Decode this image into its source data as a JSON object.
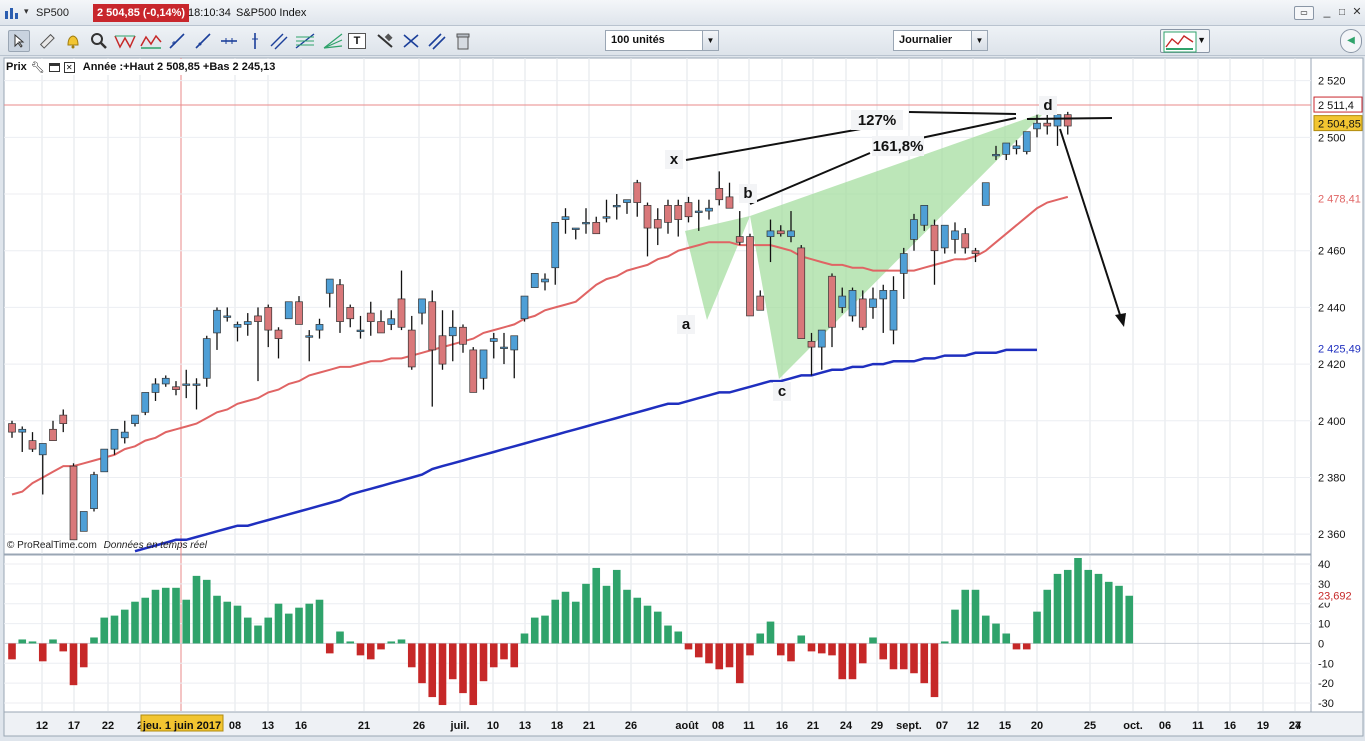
{
  "titlebar": {
    "symbol": "SP500",
    "price_badge": "2 504,85 (-0,14%)",
    "time": "18:10:34",
    "instrument": "S&P500 Index"
  },
  "toolbar": {
    "units_value": "100 unités",
    "period_value": "Journalier"
  },
  "chart_header": {
    "label": "Prix",
    "info": "Année :+Haut 2 508,85 +Bas 2 245,13"
  },
  "watermark": {
    "brand": "© ProRealTime.com",
    "realtime": "Données en temps réel"
  },
  "colors": {
    "up": "#4e9fd6",
    "down": "#d9787a",
    "ma_short": "#e06464",
    "ma_long": "#1f2fbf",
    "hist_up": "#2fa36b",
    "hist_down": "#c62828",
    "pattern_fill": "#9fdc9a"
  },
  "chart_data": [
    {
      "type": "candlestick",
      "title": "SP500",
      "ylim": [
        2353,
        2528
      ],
      "y_ticks": [
        2360,
        2380,
        2400,
        2420,
        2440,
        2460,
        2480,
        2500,
        2520
      ],
      "y_tick_labels": [
        "2 360",
        "2 380",
        "2 400",
        "2 420",
        "2 440",
        "2 460",
        "2 480",
        "2 500",
        "2 520"
      ],
      "x_tick_labels": [
        "12",
        "17",
        "22",
        "2",
        "jeu. 1 juin 2017",
        "08",
        "13",
        "16",
        "21",
        "26",
        "juil.",
        "10",
        "13",
        "18",
        "21",
        "26",
        "août",
        "08",
        "11",
        "16",
        "21",
        "24",
        "29",
        "sept.",
        "07",
        "12",
        "15",
        "20",
        "25",
        "oct.",
        "06",
        "11",
        "16",
        "19",
        "24",
        "27"
      ],
      "candles": [
        [
          2399,
          2400,
          2394,
          2396
        ],
        [
          2396,
          2398,
          2389,
          2397
        ],
        [
          2393,
          2396,
          2389,
          2390
        ],
        [
          2388,
          2392,
          2374,
          2392
        ],
        [
          2397,
          2400,
          2393,
          2393
        ],
        [
          2402,
          2404,
          2396,
          2399
        ],
        [
          2384,
          2385,
          2361,
          2358
        ],
        [
          2361,
          2368,
          2362,
          2368
        ],
        [
          2369,
          2382,
          2368,
          2381
        ],
        [
          2382,
          2390,
          2383,
          2390
        ],
        [
          2390,
          2397,
          2388,
          2397
        ],
        [
          2394,
          2400,
          2392,
          2396
        ],
        [
          2399,
          2402,
          2398,
          2402
        ],
        [
          2403,
          2410,
          2402,
          2410
        ],
        [
          2410,
          2415,
          2407,
          2413
        ],
        [
          2413,
          2416,
          2412,
          2415
        ],
        [
          2412,
          2414,
          2409,
          2411
        ],
        [
          2413,
          2418,
          2408,
          2413
        ],
        [
          2413,
          2415,
          2404,
          2413
        ],
        [
          2415,
          2430,
          2412,
          2429
        ],
        [
          2431,
          2440,
          2425,
          2439
        ],
        [
          2437,
          2440,
          2435,
          2437
        ],
        [
          2433,
          2435,
          2428,
          2434
        ],
        [
          2434,
          2438,
          2430,
          2435
        ],
        [
          2437,
          2440,
          2414,
          2435
        ],
        [
          2440,
          2441,
          2426,
          2432
        ],
        [
          2432,
          2433,
          2422,
          2429
        ],
        [
          2436,
          2442,
          2436,
          2442
        ],
        [
          2442,
          2444,
          2434,
          2434
        ],
        [
          2430,
          2432,
          2421,
          2430
        ],
        [
          2432,
          2436,
          2429,
          2434
        ],
        [
          2445,
          2450,
          2440,
          2450
        ],
        [
          2448,
          2450,
          2431,
          2435
        ],
        [
          2440,
          2441,
          2433,
          2436
        ],
        [
          2432,
          2437,
          2429,
          2432
        ],
        [
          2438,
          2442,
          2430,
          2435
        ],
        [
          2435,
          2439,
          2431,
          2431
        ],
        [
          2434,
          2439,
          2432,
          2436
        ],
        [
          2443,
          2453,
          2432,
          2433
        ],
        [
          2432,
          2437,
          2418,
          2419
        ],
        [
          2438,
          2443,
          2434,
          2443
        ],
        [
          2442,
          2446,
          2405,
          2425
        ],
        [
          2430,
          2439,
          2418,
          2420
        ],
        [
          2430,
          2439,
          2421,
          2433
        ],
        [
          2433,
          2434,
          2424,
          2427
        ],
        [
          2425,
          2426,
          2410,
          2410
        ],
        [
          2415,
          2425,
          2411,
          2425
        ],
        [
          2428,
          2431,
          2422,
          2429
        ],
        [
          2426,
          2431,
          2420,
          2426
        ],
        [
          2425,
          2429,
          2415,
          2430
        ],
        [
          2436,
          2444,
          2435,
          2444
        ],
        [
          2447,
          2452,
          2447,
          2452
        ],
        [
          2449,
          2452,
          2446,
          2450
        ],
        [
          2454,
          2466,
          2448,
          2470
        ],
        [
          2471,
          2475,
          2466,
          2472
        ],
        [
          2468,
          2468,
          2464,
          2468
        ],
        [
          2470,
          2475,
          2466,
          2470
        ],
        [
          2470,
          2472,
          2470,
          2466
        ],
        [
          2472,
          2478,
          2470,
          2472
        ],
        [
          2476,
          2480,
          2471,
          2476
        ],
        [
          2477,
          2478,
          2473,
          2478
        ],
        [
          2484,
          2485,
          2472,
          2477
        ],
        [
          2476,
          2477,
          2458,
          2468
        ],
        [
          2471,
          2475,
          2462,
          2468
        ],
        [
          2476,
          2478,
          2466,
          2470
        ],
        [
          2476,
          2478,
          2465,
          2471
        ],
        [
          2477,
          2479,
          2470,
          2472
        ],
        [
          2474,
          2478,
          2467,
          2474
        ],
        [
          2474,
          2478,
          2471,
          2475
        ],
        [
          2482,
          2488,
          2476,
          2478
        ],
        [
          2479,
          2484,
          2478,
          2475
        ],
        [
          2465,
          2474,
          2462,
          2463
        ],
        [
          2465,
          2466,
          2439,
          2437
        ],
        [
          2444,
          2446,
          2439,
          2439
        ],
        [
          2465,
          2471,
          2456,
          2467
        ],
        [
          2467,
          2469,
          2465,
          2466
        ],
        [
          2465,
          2474,
          2463,
          2467
        ],
        [
          2461,
          2462,
          2435,
          2429
        ],
        [
          2428,
          2431,
          2416,
          2426
        ],
        [
          2426,
          2431,
          2418,
          2432
        ],
        [
          2451,
          2452,
          2426,
          2433
        ],
        [
          2440,
          2447,
          2438,
          2444
        ],
        [
          2437,
          2447,
          2435,
          2446
        ],
        [
          2443,
          2446,
          2432,
          2433
        ],
        [
          2440,
          2447,
          2436,
          2443
        ],
        [
          2443,
          2448,
          2431,
          2446
        ],
        [
          2432,
          2451,
          2427,
          2446
        ],
        [
          2452,
          2461,
          2443,
          2459
        ],
        [
          2464,
          2473,
          2460,
          2471
        ],
        [
          2469,
          2473,
          2467,
          2476
        ],
        [
          2469,
          2471,
          2448,
          2460
        ],
        [
          2461,
          2468,
          2459,
          2469
        ],
        [
          2464,
          2470,
          2459,
          2467
        ],
        [
          2466,
          2468,
          2459,
          2461
        ],
        [
          2460,
          2461,
          2456,
          2459
        ],
        [
          2476,
          2484,
          2476,
          2484
        ],
        [
          2494,
          2497,
          2492,
          2494
        ],
        [
          2494,
          2498,
          2492,
          2498
        ],
        [
          2496,
          2499,
          2494,
          2497
        ],
        [
          2495,
          2502,
          2494,
          2502
        ],
        [
          2503,
          2508,
          2500,
          2505
        ],
        [
          2505,
          2508,
          2501,
          2504
        ],
        [
          2504,
          2508,
          2497,
          2508
        ],
        [
          2508,
          2509,
          2501,
          2504
        ]
      ],
      "series": [
        {
          "name": "MA20",
          "values": [
            2374,
            2375,
            2378,
            2380,
            2382,
            2384,
            2384,
            2385,
            2386,
            2387,
            2388,
            2390,
            2391,
            2393,
            2394,
            2396,
            2397,
            2398,
            2399,
            2401,
            2403,
            2404,
            2406,
            2407,
            2408,
            2410,
            2411,
            2413,
            2414,
            2416,
            2417,
            2418,
            2419,
            2419,
            2420,
            2421,
            2421,
            2422,
            2422,
            2423,
            2424,
            2425,
            2426,
            2427,
            2428,
            2429,
            2431,
            2432,
            2433,
            2434,
            2436,
            2437,
            2439,
            2440,
            2441,
            2442,
            2445,
            2448,
            2450,
            2451,
            2453,
            2454,
            2455,
            2457,
            2458,
            2460,
            2461,
            2462,
            2463,
            2463,
            2463,
            2462,
            2462,
            2462,
            2462,
            2461,
            2460,
            2458,
            2457,
            2456,
            2455,
            2455,
            2454,
            2454,
            2453,
            2453,
            2453,
            2453,
            2453,
            2454,
            2455,
            2456,
            2457,
            2457,
            2458,
            2460,
            2463,
            2466,
            2469,
            2472,
            2475,
            2477,
            2478,
            2479
          ]
        },
        {
          "name": "MA100",
          "values": [
            2354,
            2355,
            2356,
            2357,
            2358,
            2358,
            2359,
            2360,
            2361,
            2362,
            2363,
            2363,
            2364,
            2365,
            2366,
            2367,
            2368,
            2369,
            2370,
            2371,
            2372,
            2374,
            2375,
            2376,
            2377,
            2378,
            2379,
            2380,
            2381,
            2383,
            2384,
            2385,
            2386,
            2387,
            2388,
            2389,
            2390,
            2391,
            2392,
            2393,
            2394,
            2395,
            2396,
            2397,
            2398,
            2399,
            2400,
            2401,
            2402,
            2403,
            2404,
            2405,
            2406,
            2406,
            2407,
            2408,
            2409,
            2410,
            2410,
            2411,
            2412,
            2413,
            2414,
            2414,
            2415,
            2416,
            2416,
            2417,
            2418,
            2418,
            2419,
            2419,
            2420,
            2420,
            2421,
            2421,
            2421,
            2422,
            2422,
            2423,
            2423,
            2423,
            2424,
            2424,
            2424,
            2425,
            2425,
            2425,
            2425
          ]
        }
      ],
      "last_values": [
        "2 511,4",
        "2 504,85",
        "2 478,41",
        "2 425,49"
      ],
      "annotations": {
        "points": [
          "x",
          "a",
          "b",
          "c",
          "d"
        ],
        "ratios": [
          "127%",
          "161,8%"
        ]
      }
    },
    {
      "type": "bar",
      "title": "",
      "ylim": [
        -34,
        44
      ],
      "y_ticks": [
        40,
        30,
        20,
        10,
        0,
        -10,
        -20,
        -30
      ],
      "y_tick_labels": [
        "40",
        "30",
        "20",
        "10",
        "0",
        "-10",
        "-20",
        "-30"
      ],
      "last_value_label": "23,692",
      "values": [
        -8,
        2,
        1,
        -9,
        2,
        -4,
        -21,
        -12,
        3,
        13,
        14,
        17,
        21,
        23,
        27,
        28,
        28,
        22,
        34,
        32,
        24,
        21,
        19,
        13,
        9,
        13,
        20,
        15,
        18,
        20,
        22,
        -5,
        6,
        1,
        -6,
        -8,
        -3,
        1,
        2,
        -12,
        -20,
        -27,
        -31,
        -18,
        -25,
        -31,
        -19,
        -12,
        -8,
        -12,
        5,
        13,
        14,
        22,
        26,
        21,
        30,
        38,
        29,
        37,
        27,
        23,
        19,
        16,
        9,
        6,
        -3,
        -7,
        -10,
        -13,
        -12,
        -20,
        -6,
        5,
        11,
        -6,
        -9,
        4,
        -4,
        -5,
        -6,
        -18,
        -18,
        -10,
        3,
        -8,
        -13,
        -13,
        -15,
        -20,
        -27,
        1,
        17,
        27,
        27,
        14,
        10,
        5,
        -3,
        -3,
        16,
        27,
        35,
        37,
        43,
        37,
        35,
        31,
        29,
        24
      ]
    }
  ]
}
